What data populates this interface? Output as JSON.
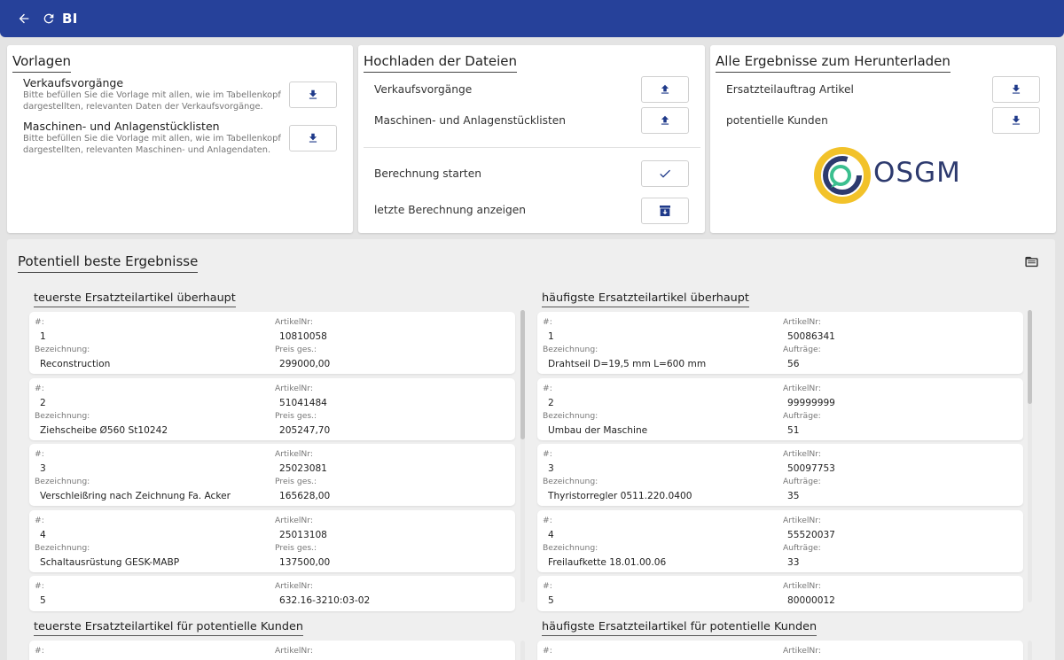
{
  "app": {
    "title": "BI",
    "back_icon": "arrow-left-icon",
    "refresh_icon": "refresh-icon",
    "color": "#26419a"
  },
  "vorlagen": {
    "title": "Vorlagen",
    "items": [
      {
        "label": "Verkaufsvorgänge",
        "hint": "Bitte befüllen Sie die Vorlage mit allen, wie im Tabellenkopf dargestellten, relevanten Daten der Verkaufsvorgänge.",
        "icon": "download-icon"
      },
      {
        "label": "Maschinen- und Anlagenstücklisten",
        "hint": "Bitte befüllen Sie die Vorlage mit allen, wie im Tabellenkopf dargestellten, relevanten Maschinen- und Anlagendaten.",
        "icon": "download-icon"
      }
    ]
  },
  "upload": {
    "title": "Hochladen der Dateien",
    "items": [
      {
        "label": "Verkaufsvorgänge",
        "icon": "upload-icon"
      },
      {
        "label": "Maschinen- und Anlagenstücklisten",
        "icon": "upload-icon"
      }
    ],
    "actions": [
      {
        "label": "Berechnung starten",
        "icon": "check-icon"
      },
      {
        "label": "letzte Berechnung anzeigen",
        "icon": "archive-icon"
      }
    ]
  },
  "results": {
    "title": "Alle Ergebnisse zum Herunterladen",
    "items": [
      {
        "label": "Ersatzteilauftrag Artikel",
        "icon": "download-icon"
      },
      {
        "label": "potentielle Kunden",
        "icon": "download-icon"
      }
    ],
    "logo_text": "OSGM"
  },
  "best": {
    "title": "Potentiell beste Ergebnisse",
    "folder_icon": "folder-icon",
    "labels": {
      "num": "#:",
      "article": "ArtikelNr:",
      "name": "Bezeichnung:",
      "price": "Preis ges.:",
      "orders": "Aufträge:"
    },
    "expensive": {
      "title": "teuerste Ersatzteilartikel überhaupt",
      "rows": [
        {
          "num": "1",
          "article": "10810058",
          "name": "Reconstruction",
          "value": "299000,00"
        },
        {
          "num": "2",
          "article": "51041484",
          "name": "Ziehscheibe  Ø560     St10242",
          "value": "205247,70"
        },
        {
          "num": "3",
          "article": "25023081",
          "name": "Verschleißring nach Zeichnung Fa. Acker",
          "value": "165628,00"
        },
        {
          "num": "4",
          "article": "25013108",
          "name": "Schaltausrüstung GESK-MABP",
          "value": "137500,00"
        },
        {
          "num": "5",
          "article": "632.16-3210:03-02",
          "name": "",
          "value": ""
        }
      ]
    },
    "frequent": {
      "title": "häufigste Ersatzteilartikel überhaupt",
      "rows": [
        {
          "num": "1",
          "article": "50086341",
          "name": "Drahtseil D=19,5 mm   L=600 mm",
          "value": "56"
        },
        {
          "num": "2",
          "article": "99999999",
          "name": "Umbau der Maschine",
          "value": "51"
        },
        {
          "num": "3",
          "article": "50097753",
          "name": "Thyristorregler 0511.220.0400",
          "value": "35"
        },
        {
          "num": "4",
          "article": "55520037",
          "name": "Freilaufkette  18.01.00.06",
          "value": "33"
        },
        {
          "num": "5",
          "article": "80000012",
          "name": "",
          "value": ""
        }
      ]
    },
    "expensive_customers": {
      "title": "teuerste Ersatzteilartikel für potentielle Kunden"
    },
    "frequent_customers": {
      "title": "häufigste Ersatzteilartikel für potentielle Kunden"
    }
  }
}
